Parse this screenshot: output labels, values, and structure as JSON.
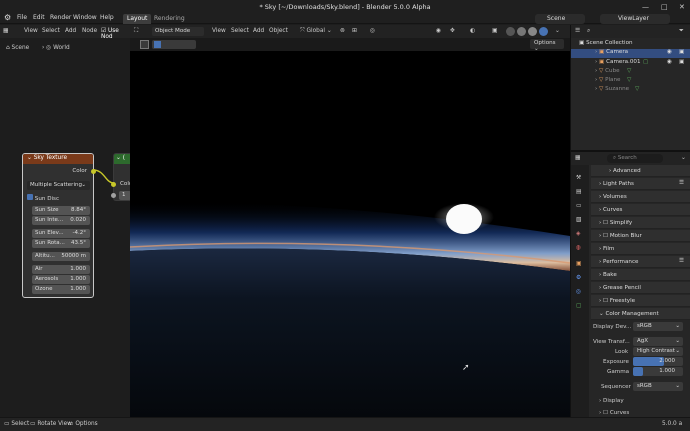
{
  "window": {
    "title": "* Sky [~/Downloads/Sky.blend] - Blender 5.0.0 Alpha",
    "min": "—",
    "max": "□",
    "close": "✕"
  },
  "menu": [
    "File",
    "Edit",
    "Render",
    "Window",
    "Help"
  ],
  "workspaces": [
    "Layout",
    "Rendering"
  ],
  "scene_field": "Scene",
  "viewlayer_field": "ViewLayer",
  "node_editor": {
    "header": [
      "View",
      "Select",
      "Add",
      "Node",
      "Use Nod"
    ],
    "breadcrumb": [
      "Scene",
      "World"
    ],
    "sky_node": {
      "title": "Sky Texture",
      "output": "Color",
      "mode": "Multiple Scattering",
      "sun_disc": "Sun Disc",
      "fields": [
        {
          "label": "Sun Size",
          "value": "8.84°"
        },
        {
          "label": "Sun Inte...",
          "value": "0.020"
        },
        {
          "label": "Sun Elev...",
          "value": "-4.2°"
        },
        {
          "label": "Sun Rota...",
          "value": "43.5°"
        },
        {
          "label": "Altitu...",
          "value": "50000 m"
        },
        {
          "label": "Air",
          "value": "1.000"
        },
        {
          "label": "Aerosols",
          "value": "1.000"
        },
        {
          "label": "Ozone",
          "value": "1.000"
        }
      ]
    },
    "bg_node": {
      "title": "(",
      "input": "Colo",
      "strength": "1"
    }
  },
  "viewport": {
    "mode": "Object Mode",
    "header": [
      "View",
      "Select",
      "Add",
      "Object"
    ],
    "transform": "Global",
    "options": "Options"
  },
  "outliner": {
    "title": "Scene Collection",
    "items": [
      {
        "name": "Camera",
        "selected": true
      },
      {
        "name": "Camera.001",
        "selected": false
      },
      {
        "name": "Cube",
        "selected": false
      },
      {
        "name": "Plane",
        "selected": false
      },
      {
        "name": "Suzanne",
        "selected": false
      }
    ]
  },
  "properties": {
    "search_placeholder": "Search",
    "panels": [
      "Advanced",
      "Light Paths",
      "Volumes",
      "Curves",
      "Simplify",
      "Motion Blur",
      "Film",
      "Performance",
      "Bake",
      "Grease Pencil",
      "Freestyle",
      "Color Management"
    ],
    "color_management": {
      "display_device_label": "Display Dev...",
      "display_device": "sRGB",
      "view_transform_label": "View Transf...",
      "view_transform": "AgX",
      "look_label": "Look",
      "look": "High Contrast",
      "exposure_label": "Exposure",
      "exposure": "2.000",
      "exposure_fill": 0.62,
      "gamma_label": "Gamma",
      "gamma": "1.000",
      "gamma_fill": 0.2,
      "sequencer_label": "Sequencer",
      "sequencer": "sRGB",
      "sub": [
        "Display",
        "Curves"
      ]
    }
  },
  "statusbar": {
    "items": [
      "Select",
      "Rotate View",
      "Options"
    ],
    "version": "5.0.0 a"
  },
  "colors": {
    "accent": "#4772b3",
    "node_head": "#7a3a1a",
    "bg_node_head": "#2d6a2d"
  }
}
